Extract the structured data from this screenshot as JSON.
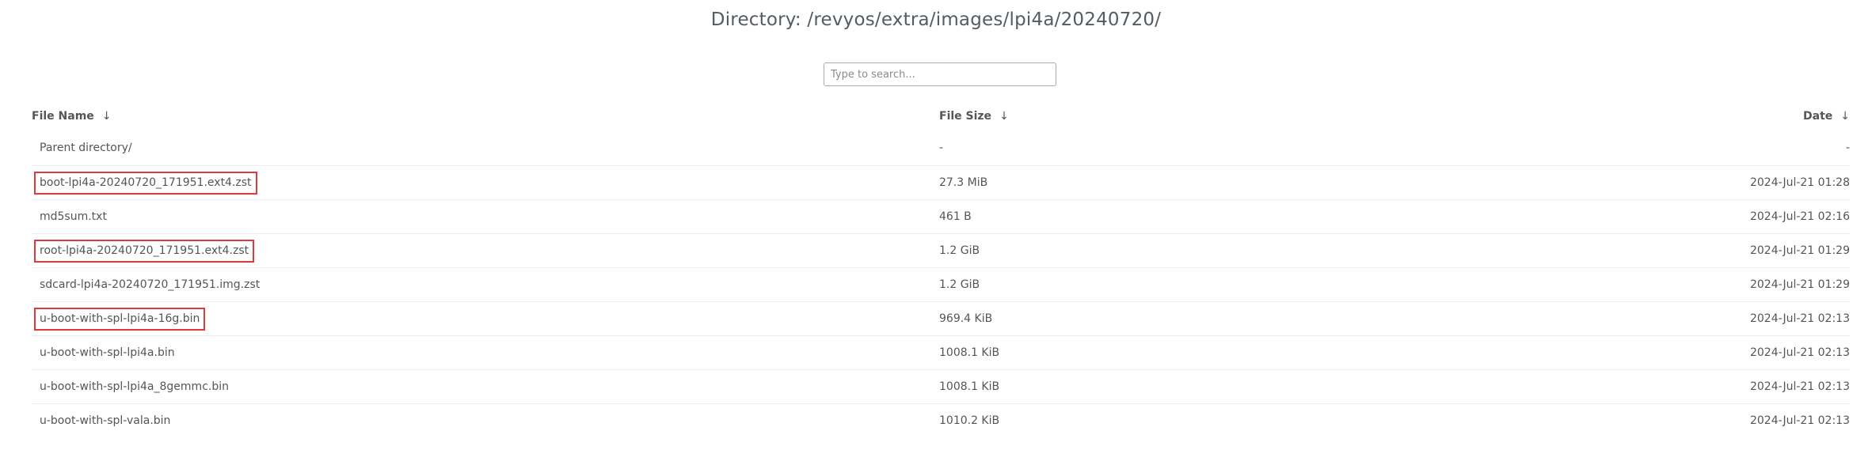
{
  "page": {
    "title": "Directory: /revyos/extra/images/lpi4a/20240720/"
  },
  "search": {
    "placeholder": "Type to search...",
    "value": ""
  },
  "table": {
    "headers": {
      "name": "File Name",
      "size": "File Size",
      "date": "Date",
      "sort_icon": "down-arrow-icon",
      "sort_glyph": "↓"
    },
    "rows": [
      {
        "name": "Parent directory/",
        "size": "-",
        "date": "-",
        "highlighted": false
      },
      {
        "name": "boot-lpi4a-20240720_171951.ext4.zst",
        "size": "27.3 MiB",
        "date": "2024-Jul-21 01:28",
        "highlighted": true
      },
      {
        "name": "md5sum.txt",
        "size": "461 B",
        "date": "2024-Jul-21 02:16",
        "highlighted": false
      },
      {
        "name": "root-lpi4a-20240720_171951.ext4.zst",
        "size": "1.2 GiB",
        "date": "2024-Jul-21 01:29",
        "highlighted": true
      },
      {
        "name": "sdcard-lpi4a-20240720_171951.img.zst",
        "size": "1.2 GiB",
        "date": "2024-Jul-21 01:29",
        "highlighted": false
      },
      {
        "name": "u-boot-with-spl-lpi4a-16g.bin",
        "size": "969.4 KiB",
        "date": "2024-Jul-21 02:13",
        "highlighted": true
      },
      {
        "name": "u-boot-with-spl-lpi4a.bin",
        "size": "1008.1 KiB",
        "date": "2024-Jul-21 02:13",
        "highlighted": false
      },
      {
        "name": "u-boot-with-spl-lpi4a_8gemmc.bin",
        "size": "1008.1 KiB",
        "date": "2024-Jul-21 02:13",
        "highlighted": false
      },
      {
        "name": "u-boot-with-spl-vala.bin",
        "size": "1010.2 KiB",
        "date": "2024-Jul-21 02:13",
        "highlighted": false
      }
    ]
  },
  "colors": {
    "highlight_border": "#e23a3a",
    "text": "#555555",
    "row_divider": "#eeeeee"
  }
}
